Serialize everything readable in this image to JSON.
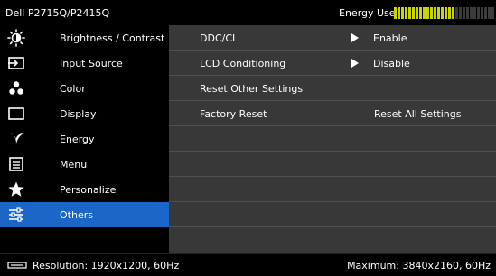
{
  "header": {
    "model": "Dell P2715Q/P2415Q",
    "energy_label": "Energy Use",
    "energy_level": 0.6
  },
  "menu": {
    "items": [
      {
        "label": "Brightness / Contrast",
        "icon": "brightness-icon"
      },
      {
        "label": "Input Source",
        "icon": "input-source-icon"
      },
      {
        "label": "Color",
        "icon": "color-icon"
      },
      {
        "label": "Display",
        "icon": "display-icon"
      },
      {
        "label": "Energy",
        "icon": "energy-icon"
      },
      {
        "label": "Menu",
        "icon": "menu-icon"
      },
      {
        "label": "Personalize",
        "icon": "star-icon"
      },
      {
        "label": "Others",
        "icon": "others-icon",
        "selected": true
      }
    ]
  },
  "panel": {
    "rows": [
      {
        "label": "DDC/CI",
        "value": "Enable",
        "arrow": true
      },
      {
        "label": "LCD Conditioning",
        "value": "Disable",
        "arrow": true
      },
      {
        "label": "Reset Other Settings",
        "value": "",
        "arrow": false
      },
      {
        "label": "Factory Reset",
        "value": "Reset All Settings",
        "arrow": false
      }
    ]
  },
  "footer": {
    "resolution": "Resolution: 1920x1200, 60Hz",
    "maximum": "Maximum: 3840x2160, 60Hz"
  },
  "colors": {
    "selected": "#1b66c6",
    "panel": "#383838",
    "energy_on": "#c9d500"
  }
}
